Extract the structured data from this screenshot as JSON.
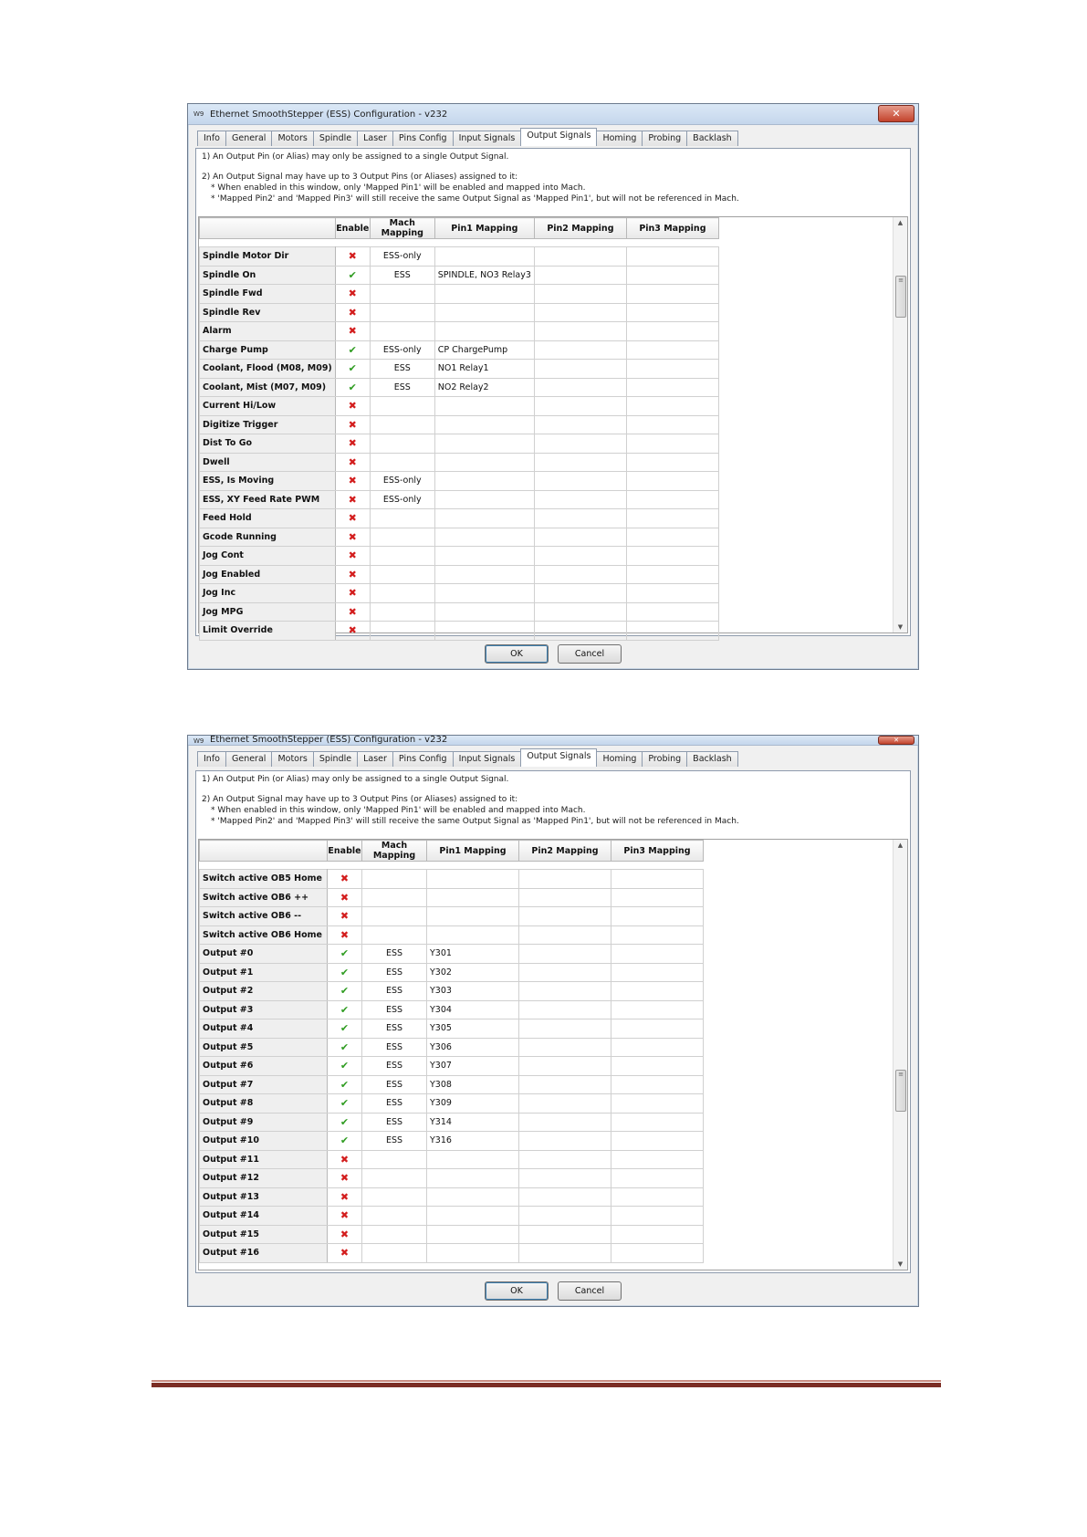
{
  "windows": [
    {
      "title": "Ethernet SmoothStepper (ESS) Configuration - v232",
      "app_icon": "W9",
      "tabs": [
        "Info",
        "General",
        "Motors",
        "Spindle",
        "Laser",
        "Pins Config",
        "Input Signals",
        "Output Signals",
        "Homing",
        "Probing",
        "Backlash"
      ],
      "active_tab": "Output Signals",
      "notes": {
        "line1": "1) An Output Pin (or Alias) may only be assigned to a single Output Signal.",
        "line2": "2) An Output Signal may have up to 3 Output Pins (or Aliases) assigned to it:",
        "line3": "* When enabled in this window, only 'Mapped Pin1' will be enabled and mapped into Mach.",
        "line4": "* 'Mapped Pin2' and 'Mapped Pin3' will still receive the same Output Signal as 'Mapped Pin1', but will not be referenced in Mach."
      },
      "columns": [
        "",
        "Enable",
        "Mach Mapping",
        "Pin1 Mapping",
        "Pin2 Mapping",
        "Pin3 Mapping"
      ],
      "rows": [
        {
          "name": "Spindle Motor Dir",
          "enabled": false,
          "mach": "ESS-only",
          "pin1": "",
          "pin2": "",
          "pin3": ""
        },
        {
          "name": "Spindle On",
          "enabled": true,
          "mach": "ESS",
          "pin1": "SPINDLE, NO3 Relay3",
          "pin2": "",
          "pin3": ""
        },
        {
          "name": "Spindle Fwd",
          "enabled": false,
          "mach": "",
          "pin1": "",
          "pin2": "",
          "pin3": ""
        },
        {
          "name": "Spindle Rev",
          "enabled": false,
          "mach": "",
          "pin1": "",
          "pin2": "",
          "pin3": ""
        },
        {
          "name": "Alarm",
          "enabled": false,
          "mach": "",
          "pin1": "",
          "pin2": "",
          "pin3": ""
        },
        {
          "name": "Charge Pump",
          "enabled": true,
          "mach": "ESS-only",
          "pin1": "CP ChargePump",
          "pin2": "",
          "pin3": ""
        },
        {
          "name": "Coolant, Flood (M08, M09)",
          "enabled": true,
          "mach": "ESS",
          "pin1": "NO1 Relay1",
          "pin2": "",
          "pin3": ""
        },
        {
          "name": "Coolant, Mist (M07, M09)",
          "enabled": true,
          "mach": "ESS",
          "pin1": "NO2 Relay2",
          "pin2": "",
          "pin3": ""
        },
        {
          "name": "Current Hi/Low",
          "enabled": false,
          "mach": "",
          "pin1": "",
          "pin2": "",
          "pin3": ""
        },
        {
          "name": "Digitize Trigger",
          "enabled": false,
          "mach": "",
          "pin1": "",
          "pin2": "",
          "pin3": ""
        },
        {
          "name": "Dist To Go",
          "enabled": false,
          "mach": "",
          "pin1": "",
          "pin2": "",
          "pin3": ""
        },
        {
          "name": "Dwell",
          "enabled": false,
          "mach": "",
          "pin1": "",
          "pin2": "",
          "pin3": ""
        },
        {
          "name": "ESS, Is Moving",
          "enabled": false,
          "mach": "ESS-only",
          "pin1": "",
          "pin2": "",
          "pin3": ""
        },
        {
          "name": "ESS, XY Feed Rate PWM",
          "enabled": false,
          "mach": "ESS-only",
          "pin1": "",
          "pin2": "",
          "pin3": ""
        },
        {
          "name": "Feed Hold",
          "enabled": false,
          "mach": "",
          "pin1": "",
          "pin2": "",
          "pin3": ""
        },
        {
          "name": "Gcode Running",
          "enabled": false,
          "mach": "",
          "pin1": "",
          "pin2": "",
          "pin3": ""
        },
        {
          "name": "Jog Cont",
          "enabled": false,
          "mach": "",
          "pin1": "",
          "pin2": "",
          "pin3": ""
        },
        {
          "name": "Jog Enabled",
          "enabled": false,
          "mach": "",
          "pin1": "",
          "pin2": "",
          "pin3": ""
        },
        {
          "name": "Jog Inc",
          "enabled": false,
          "mach": "",
          "pin1": "",
          "pin2": "",
          "pin3": ""
        },
        {
          "name": "Jog MPG",
          "enabled": false,
          "mach": "",
          "pin1": "",
          "pin2": "",
          "pin3": ""
        },
        {
          "name": "Limit Override",
          "enabled": false,
          "mach": "",
          "pin1": "",
          "pin2": "",
          "pin3": ""
        }
      ],
      "scroll_position": 0.13,
      "ok_label": "OK",
      "cancel_label": "Cancel"
    },
    {
      "title": "Ethernet SmoothStepper (ESS) Configuration - v232",
      "app_icon": "W9",
      "tabs": [
        "Info",
        "General",
        "Motors",
        "Spindle",
        "Laser",
        "Pins Config",
        "Input Signals",
        "Output Signals",
        "Homing",
        "Probing",
        "Backlash"
      ],
      "active_tab": "Output Signals",
      "notes": {
        "line1": "1) An Output Pin (or Alias) may only be assigned to a single Output Signal.",
        "line2": "2) An Output Signal may have up to 3 Output Pins (or Aliases) assigned to it:",
        "line3": "* When enabled in this window, only 'Mapped Pin1' will be enabled and mapped into Mach.",
        "line4": "* 'Mapped Pin2' and 'Mapped Pin3' will still receive the same Output Signal as 'Mapped Pin1', but will not be referenced in Mach."
      },
      "columns": [
        "",
        "Enable",
        "Mach Mapping",
        "Pin1 Mapping",
        "Pin2 Mapping",
        "Pin3 Mapping"
      ],
      "rows": [
        {
          "name": "Switch active OB5 Home",
          "enabled": false,
          "mach": "",
          "pin1": "",
          "pin2": "",
          "pin3": ""
        },
        {
          "name": "Switch active OB6 ++",
          "enabled": false,
          "mach": "",
          "pin1": "",
          "pin2": "",
          "pin3": ""
        },
        {
          "name": "Switch active OB6 --",
          "enabled": false,
          "mach": "",
          "pin1": "",
          "pin2": "",
          "pin3": ""
        },
        {
          "name": "Switch active OB6 Home",
          "enabled": false,
          "mach": "",
          "pin1": "",
          "pin2": "",
          "pin3": ""
        },
        {
          "name": "Output #0",
          "enabled": true,
          "mach": "ESS",
          "pin1": "Y301",
          "pin2": "",
          "pin3": ""
        },
        {
          "name": "Output #1",
          "enabled": true,
          "mach": "ESS",
          "pin1": "Y302",
          "pin2": "",
          "pin3": ""
        },
        {
          "name": "Output #2",
          "enabled": true,
          "mach": "ESS",
          "pin1": "Y303",
          "pin2": "",
          "pin3": ""
        },
        {
          "name": "Output #3",
          "enabled": true,
          "mach": "ESS",
          "pin1": "Y304",
          "pin2": "",
          "pin3": ""
        },
        {
          "name": "Output #4",
          "enabled": true,
          "mach": "ESS",
          "pin1": "Y305",
          "pin2": "",
          "pin3": ""
        },
        {
          "name": "Output #5",
          "enabled": true,
          "mach": "ESS",
          "pin1": "Y306",
          "pin2": "",
          "pin3": ""
        },
        {
          "name": "Output #6",
          "enabled": true,
          "mach": "ESS",
          "pin1": "Y307",
          "pin2": "",
          "pin3": ""
        },
        {
          "name": "Output #7",
          "enabled": true,
          "mach": "ESS",
          "pin1": "Y308",
          "pin2": "",
          "pin3": ""
        },
        {
          "name": "Output #8",
          "enabled": true,
          "mach": "ESS",
          "pin1": "Y309",
          "pin2": "",
          "pin3": ""
        },
        {
          "name": "Output #9",
          "enabled": true,
          "mach": "ESS",
          "pin1": "Y314",
          "pin2": "",
          "pin3": ""
        },
        {
          "name": "Output #10",
          "enabled": true,
          "mach": "ESS",
          "pin1": "Y316",
          "pin2": "",
          "pin3": ""
        },
        {
          "name": "Output #11",
          "enabled": false,
          "mach": "",
          "pin1": "",
          "pin2": "",
          "pin3": ""
        },
        {
          "name": "Output #12",
          "enabled": false,
          "mach": "",
          "pin1": "",
          "pin2": "",
          "pin3": ""
        },
        {
          "name": "Output #13",
          "enabled": false,
          "mach": "",
          "pin1": "",
          "pin2": "",
          "pin3": ""
        },
        {
          "name": "Output #14",
          "enabled": false,
          "mach": "",
          "pin1": "",
          "pin2": "",
          "pin3": ""
        },
        {
          "name": "Output #15",
          "enabled": false,
          "mach": "",
          "pin1": "",
          "pin2": "",
          "pin3": ""
        },
        {
          "name": "Output #16",
          "enabled": false,
          "mach": "",
          "pin1": "",
          "pin2": "",
          "pin3": ""
        }
      ],
      "scroll_position": 0.6,
      "ok_label": "OK",
      "cancel_label": "Cancel"
    }
  ],
  "icons": {
    "enabled": "green-check-icon",
    "disabled": "red-x-icon",
    "close": "close-icon"
  },
  "colors": {
    "check": "#2f9c21",
    "cross": "#d31d1d",
    "rule_dark": "#7b2d24",
    "rule_light": "#c98c82"
  }
}
